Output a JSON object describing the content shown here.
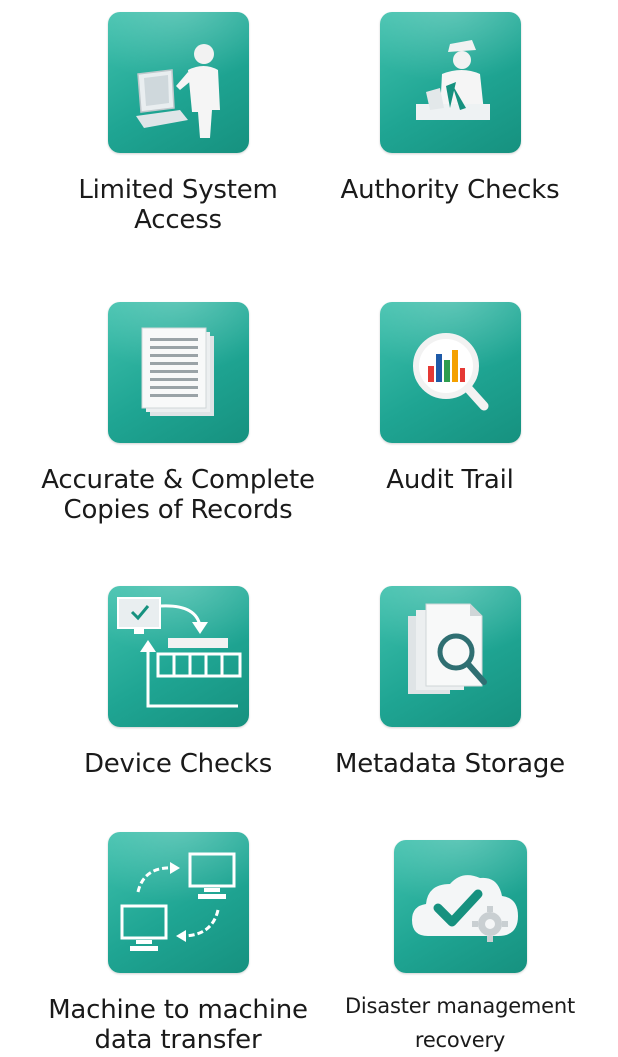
{
  "tiles": [
    {
      "id": "limited-system-access",
      "label": "Limited System\nAccess",
      "icon": "user-at-computer-icon"
    },
    {
      "id": "authority-checks",
      "label": "Authority Checks",
      "icon": "guard-signing-icon"
    },
    {
      "id": "accurate-complete-copies",
      "label": "Accurate & Complete\nCopies of Records",
      "icon": "document-stack-icon"
    },
    {
      "id": "audit-trail",
      "label": "Audit Trail",
      "icon": "magnifier-bar-chart-icon"
    },
    {
      "id": "device-checks",
      "label": "Device Checks",
      "icon": "monitor-device-loop-icon"
    },
    {
      "id": "metadata-storage",
      "label": "Metadata Storage",
      "icon": "documents-magnifier-icon"
    },
    {
      "id": "machine-to-machine",
      "label": "Machine to machine\ndata transfer",
      "icon": "computers-exchange-icon"
    },
    {
      "id": "disaster-management",
      "label": "Disaster management\nrecovery",
      "icon": "cloud-check-gear-icon"
    }
  ],
  "colors": {
    "tile": "#1fa593",
    "text": "#1a1a1a"
  }
}
